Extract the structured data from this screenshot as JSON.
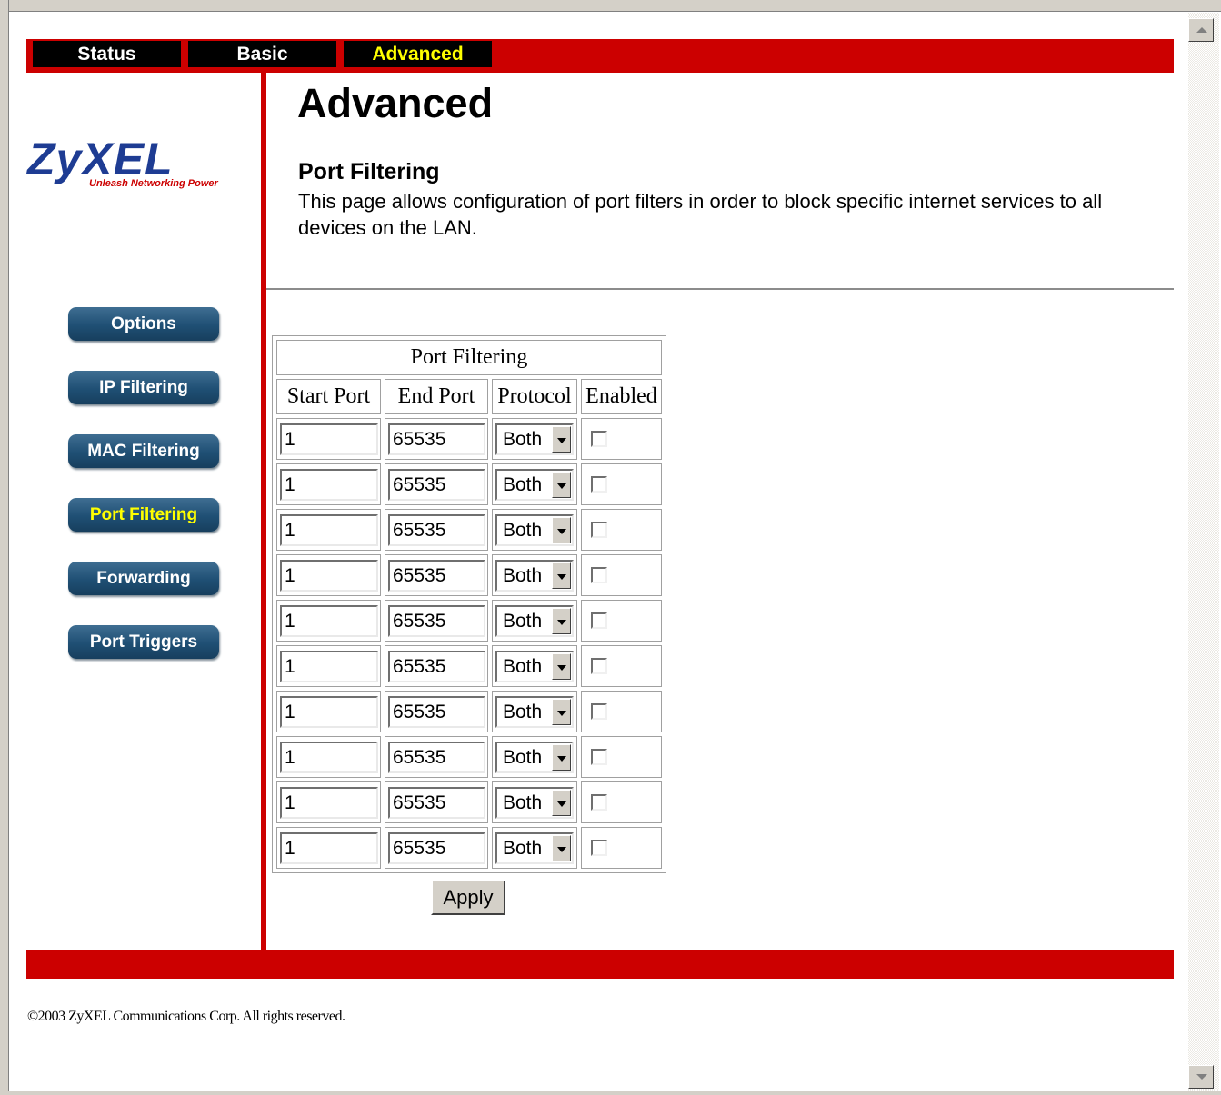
{
  "nav": {
    "tabs": [
      {
        "label": "Status"
      },
      {
        "label": "Basic"
      },
      {
        "label": "Advanced"
      }
    ],
    "active_tab": "Advanced"
  },
  "logo": {
    "word": "ZyXEL",
    "tagline": "Unleash Networking Power"
  },
  "sidebar": {
    "items": [
      {
        "label": "Options"
      },
      {
        "label": "IP Filtering"
      },
      {
        "label": "MAC Filtering"
      },
      {
        "label": "Port Filtering"
      },
      {
        "label": "Forwarding"
      },
      {
        "label": "Port Triggers"
      }
    ],
    "active_item": "Port Filtering"
  },
  "main": {
    "page_title": "Advanced",
    "section_title": "Port Filtering",
    "section_desc": "This page allows configuration of port filters in order to block specific internet services to all devices on the LAN."
  },
  "table": {
    "caption": "Port Filtering",
    "headers": [
      "Start Port",
      "End Port",
      "Protocol",
      "Enabled"
    ],
    "rows": [
      {
        "start": "1",
        "end": "65535",
        "protocol": "Both",
        "enabled": false
      },
      {
        "start": "1",
        "end": "65535",
        "protocol": "Both",
        "enabled": false
      },
      {
        "start": "1",
        "end": "65535",
        "protocol": "Both",
        "enabled": false
      },
      {
        "start": "1",
        "end": "65535",
        "protocol": "Both",
        "enabled": false
      },
      {
        "start": "1",
        "end": "65535",
        "protocol": "Both",
        "enabled": false
      },
      {
        "start": "1",
        "end": "65535",
        "protocol": "Both",
        "enabled": false
      },
      {
        "start": "1",
        "end": "65535",
        "protocol": "Both",
        "enabled": false
      },
      {
        "start": "1",
        "end": "65535",
        "protocol": "Both",
        "enabled": false
      },
      {
        "start": "1",
        "end": "65535",
        "protocol": "Both",
        "enabled": false
      },
      {
        "start": "1",
        "end": "65535",
        "protocol": "Both",
        "enabled": false
      }
    ],
    "apply_label": "Apply"
  },
  "footer": {
    "copyright": "©2003 ZyXEL Communications Corp.   All rights reserved."
  },
  "colors": {
    "brand_red": "#cc0000",
    "tab_active_text": "#ffff00",
    "logo_blue": "#1e3c93",
    "side_button": "#1f4f74"
  }
}
